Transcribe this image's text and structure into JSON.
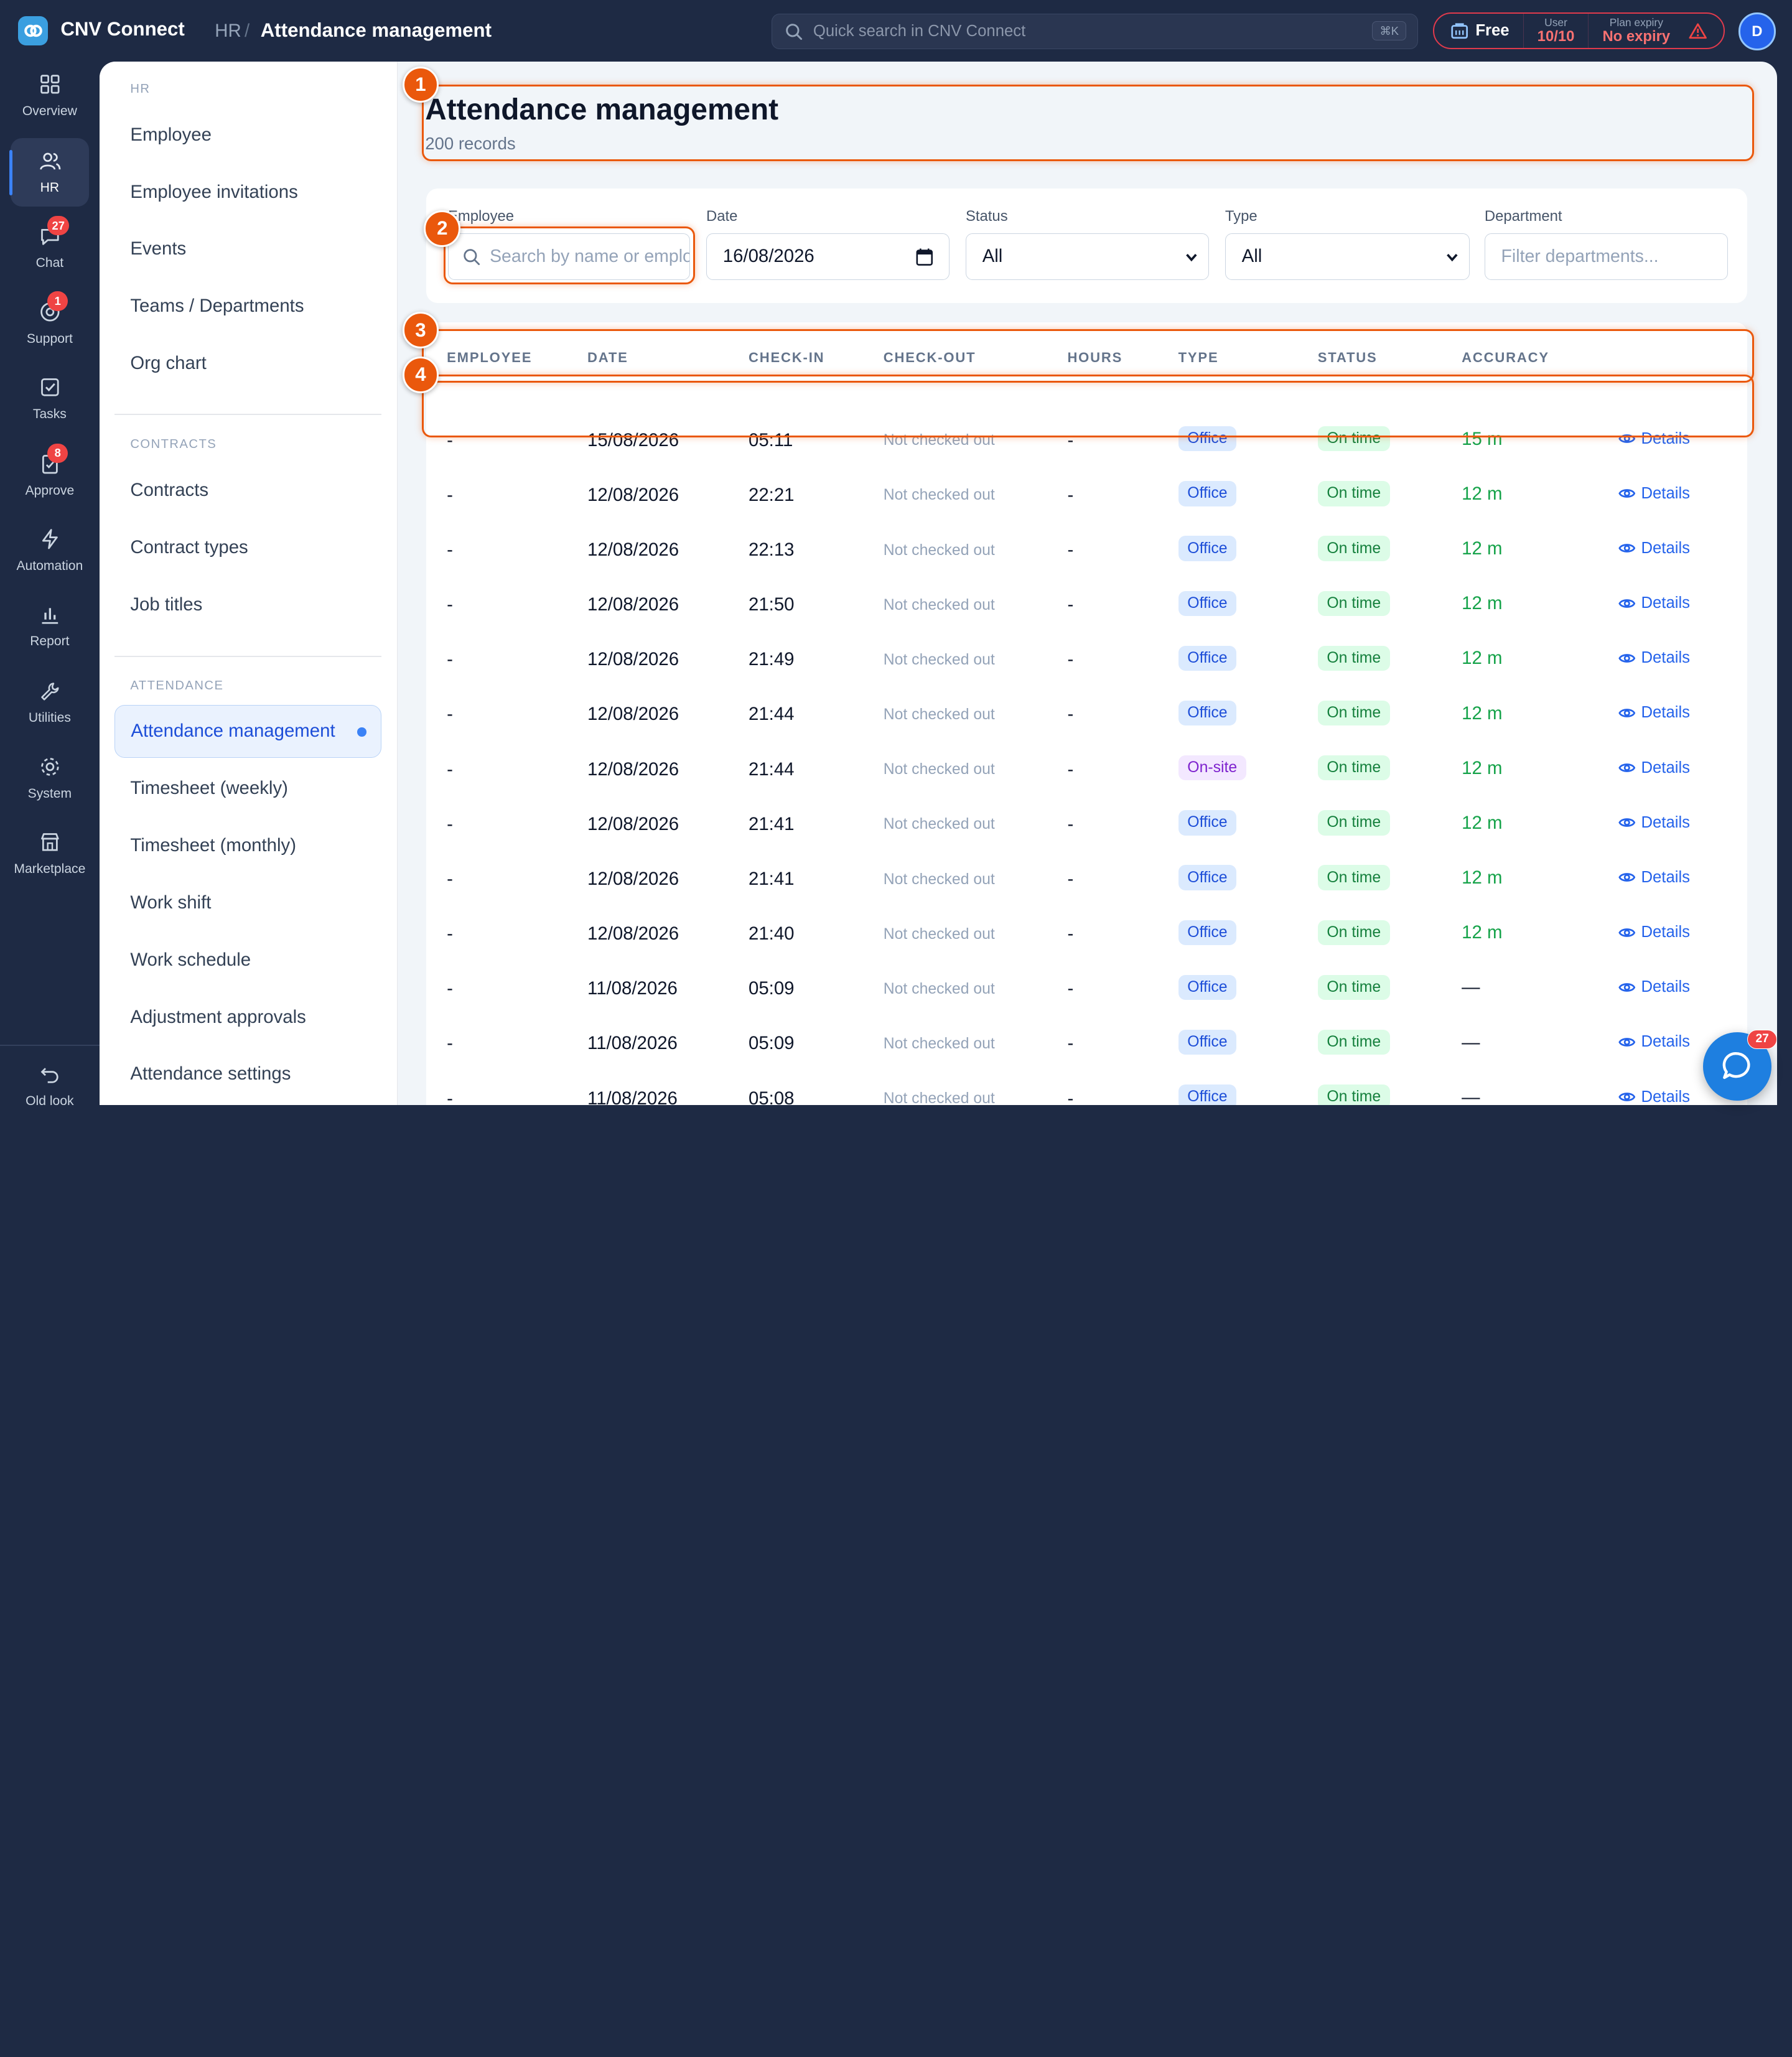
{
  "app": {
    "name": "CNV Connect"
  },
  "breadcrumb": {
    "root": "HR",
    "separator": "/",
    "current": "Attendance management"
  },
  "search": {
    "placeholder": "Quick search in CNV Connect",
    "shortcut": "⌘K"
  },
  "plan": {
    "name": "Free",
    "user_label": "User",
    "user_value": "10/10",
    "expiry_label": "Plan expiry",
    "expiry_value": "No expiry"
  },
  "avatar": {
    "initial": "D"
  },
  "rail": [
    {
      "label": "Overview",
      "icon": "grid-icon"
    },
    {
      "label": "HR",
      "icon": "users-icon",
      "active": true
    },
    {
      "label": "Chat",
      "icon": "chat-icon",
      "badge": "27"
    },
    {
      "label": "Support",
      "icon": "support-icon",
      "badge": "1"
    },
    {
      "label": "Tasks",
      "icon": "checkbox-icon"
    },
    {
      "label": "Approve",
      "icon": "approve-icon",
      "badge": "8"
    },
    {
      "label": "Automation",
      "icon": "bolt-icon"
    },
    {
      "label": "Report",
      "icon": "bar-chart-icon"
    },
    {
      "label": "Utilities",
      "icon": "wrench-icon"
    },
    {
      "label": "System",
      "icon": "gear-icon"
    },
    {
      "label": "Marketplace",
      "icon": "store-icon"
    }
  ],
  "rail_footer": {
    "label": "Old look",
    "icon": "undo-icon"
  },
  "subnav": {
    "sections": [
      {
        "title": "HR",
        "items": [
          "Employee",
          "Employee invitations",
          "Events",
          "Teams / Departments",
          "Org chart"
        ]
      },
      {
        "title": "CONTRACTS",
        "items": [
          "Contracts",
          "Contract types",
          "Job titles"
        ]
      },
      {
        "title": "ATTENDANCE",
        "items": [
          "Attendance management",
          "Timesheet (weekly)",
          "Timesheet (monthly)",
          "Work shift",
          "Work schedule",
          "Adjustment approvals",
          "Attendance settings"
        ]
      }
    ],
    "active_item": "Attendance management"
  },
  "page": {
    "title": "Attendance management",
    "subtitle": "200 records"
  },
  "filters": {
    "employee": {
      "label": "Employee",
      "placeholder": "Search by name or employee code"
    },
    "date": {
      "label": "Date",
      "value": "16/08/2026"
    },
    "status": {
      "label": "Status",
      "value": "All"
    },
    "type": {
      "label": "Type",
      "value": "All"
    },
    "department": {
      "label": "Department",
      "placeholder": "Filter departments..."
    }
  },
  "table": {
    "columns": [
      "EMPLOYEE",
      "DATE",
      "CHECK-IN",
      "CHECK-OUT",
      "HOURS",
      "TYPE",
      "STATUS",
      "ACCURACY"
    ],
    "details_label": "Details",
    "rows": [
      {
        "employee": "-",
        "date": "15/08/2026",
        "check_in": "05:11",
        "check_out": "Not checked out",
        "hours": "-",
        "type": "Office",
        "status": "On time",
        "accuracy": "15 m"
      },
      {
        "employee": "-",
        "date": "12/08/2026",
        "check_in": "22:21",
        "check_out": "Not checked out",
        "hours": "-",
        "type": "Office",
        "status": "On time",
        "accuracy": "12 m"
      },
      {
        "employee": "-",
        "date": "12/08/2026",
        "check_in": "22:13",
        "check_out": "Not checked out",
        "hours": "-",
        "type": "Office",
        "status": "On time",
        "accuracy": "12 m"
      },
      {
        "employee": "-",
        "date": "12/08/2026",
        "check_in": "21:50",
        "check_out": "Not checked out",
        "hours": "-",
        "type": "Office",
        "status": "On time",
        "accuracy": "12 m"
      },
      {
        "employee": "-",
        "date": "12/08/2026",
        "check_in": "21:49",
        "check_out": "Not checked out",
        "hours": "-",
        "type": "Office",
        "status": "On time",
        "accuracy": "12 m"
      },
      {
        "employee": "-",
        "date": "12/08/2026",
        "check_in": "21:44",
        "check_out": "Not checked out",
        "hours": "-",
        "type": "Office",
        "status": "On time",
        "accuracy": "12 m"
      },
      {
        "employee": "-",
        "date": "12/08/2026",
        "check_in": "21:44",
        "check_out": "Not checked out",
        "hours": "-",
        "type": "On-site",
        "status": "On time",
        "accuracy": "12 m"
      },
      {
        "employee": "-",
        "date": "12/08/2026",
        "check_in": "21:41",
        "check_out": "Not checked out",
        "hours": "-",
        "type": "Office",
        "status": "On time",
        "accuracy": "12 m"
      },
      {
        "employee": "-",
        "date": "12/08/2026",
        "check_in": "21:41",
        "check_out": "Not checked out",
        "hours": "-",
        "type": "Office",
        "status": "On time",
        "accuracy": "12 m"
      },
      {
        "employee": "-",
        "date": "12/08/2026",
        "check_in": "21:40",
        "check_out": "Not checked out",
        "hours": "-",
        "type": "Office",
        "status": "On time",
        "accuracy": "12 m"
      },
      {
        "employee": "-",
        "date": "11/08/2026",
        "check_in": "05:09",
        "check_out": "Not checked out",
        "hours": "-",
        "type": "Office",
        "status": "On time",
        "accuracy": "—"
      },
      {
        "employee": "-",
        "date": "11/08/2026",
        "check_in": "05:09",
        "check_out": "Not checked out",
        "hours": "-",
        "type": "Office",
        "status": "On time",
        "accuracy": "—"
      },
      {
        "employee": "-",
        "date": "11/08/2026",
        "check_in": "05:08",
        "check_out": "Not checked out",
        "hours": "-",
        "type": "Office",
        "status": "On time",
        "accuracy": "—"
      }
    ]
  },
  "annotations": [
    "1",
    "2",
    "3",
    "4"
  ],
  "chat_fab": {
    "badge": "27"
  },
  "colors": {
    "rail_bg": "#1e2a44",
    "accent": "#2563eb",
    "highlight": "#ea580c",
    "success": "#16a34a",
    "danger": "#ef4444"
  }
}
